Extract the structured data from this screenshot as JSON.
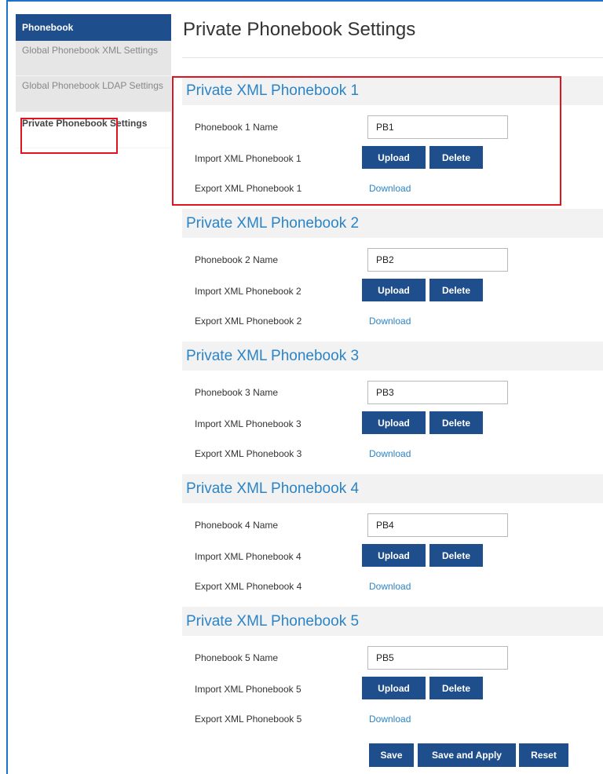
{
  "sidebar": {
    "header": "Phonebook",
    "items": [
      {
        "label": "Global Phonebook XML Settings"
      },
      {
        "label": "Global Phonebook LDAP Settings"
      },
      {
        "label": "Private Phonebook Settings"
      }
    ]
  },
  "page": {
    "title": "Private Phonebook Settings"
  },
  "sections": [
    {
      "title": "Private XML Phonebook 1",
      "name_label": "Phonebook 1 Name",
      "name_value": "PB1",
      "import_label": "Import XML Phonebook 1",
      "export_label": "Export XML Phonebook 1"
    },
    {
      "title": "Private XML Phonebook 2",
      "name_label": "Phonebook 2 Name",
      "name_value": "PB2",
      "import_label": "Import XML Phonebook 2",
      "export_label": "Export XML Phonebook 2"
    },
    {
      "title": "Private XML Phonebook 3",
      "name_label": "Phonebook 3 Name",
      "name_value": "PB3",
      "import_label": "Import XML Phonebook 3",
      "export_label": "Export XML Phonebook 3"
    },
    {
      "title": "Private XML Phonebook 4",
      "name_label": "Phonebook 4 Name",
      "name_value": "PB4",
      "import_label": "Import XML Phonebook 4",
      "export_label": "Export XML Phonebook 4"
    },
    {
      "title": "Private XML Phonebook 5",
      "name_label": "Phonebook 5 Name",
      "name_value": "PB5",
      "import_label": "Import XML Phonebook 5",
      "export_label": "Export XML Phonebook 5"
    }
  ],
  "labels": {
    "upload": "Upload",
    "delete": "Delete",
    "download": "Download"
  },
  "footer": {
    "save": "Save",
    "save_apply": "Save and Apply",
    "reset": "Reset"
  },
  "colors": {
    "accent": "#1f4e8c",
    "link": "#2b84c6",
    "highlight": "#e0141e",
    "section_bg": "#f2f2f2"
  }
}
